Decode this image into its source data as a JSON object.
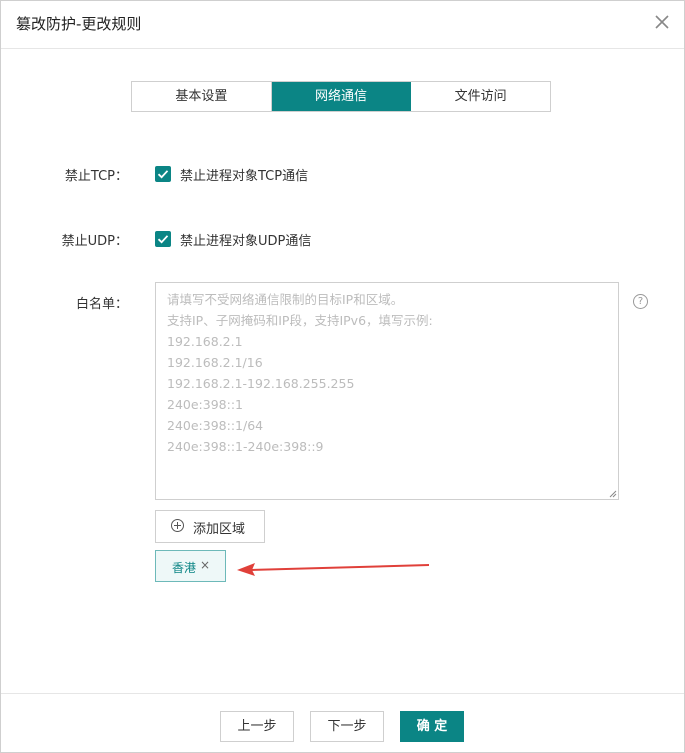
{
  "dialog": {
    "title": "篡改防护-更改规则",
    "close_icon": "close-icon"
  },
  "tabs": [
    {
      "label": "基本设置",
      "active": false
    },
    {
      "label": "网络通信",
      "active": true
    },
    {
      "label": "文件访问",
      "active": false
    }
  ],
  "form": {
    "tcp": {
      "label": "禁止TCP：",
      "checkbox_label": "禁止进程对象TCP通信",
      "checked": true
    },
    "udp": {
      "label": "禁止UDP：",
      "checkbox_label": "禁止进程对象UDP通信",
      "checked": true
    },
    "whitelist": {
      "label": "白名单：",
      "value": "",
      "placeholder": "请填写不受网络通信限制的目标IP和区域。\n支持IP、子网掩码和IP段，支持IPv6，填写示例:\n192.168.2.1\n192.168.2.1/16\n192.168.2.1-192.168.255.255\n240e:398::1\n240e:398::1/64\n240e:398::1-240e:398::9",
      "help_icon": "question-circle-icon",
      "help_symbol": "?"
    },
    "add_region_button": "添加区域",
    "region_tags": [
      {
        "label": "香港",
        "remove": "×"
      }
    ]
  },
  "footer": {
    "prev_label": "上一步",
    "next_label": "下一步",
    "confirm_label": "确 定"
  },
  "colors": {
    "accent": "#0b8585",
    "arrow": "#e0403a"
  }
}
